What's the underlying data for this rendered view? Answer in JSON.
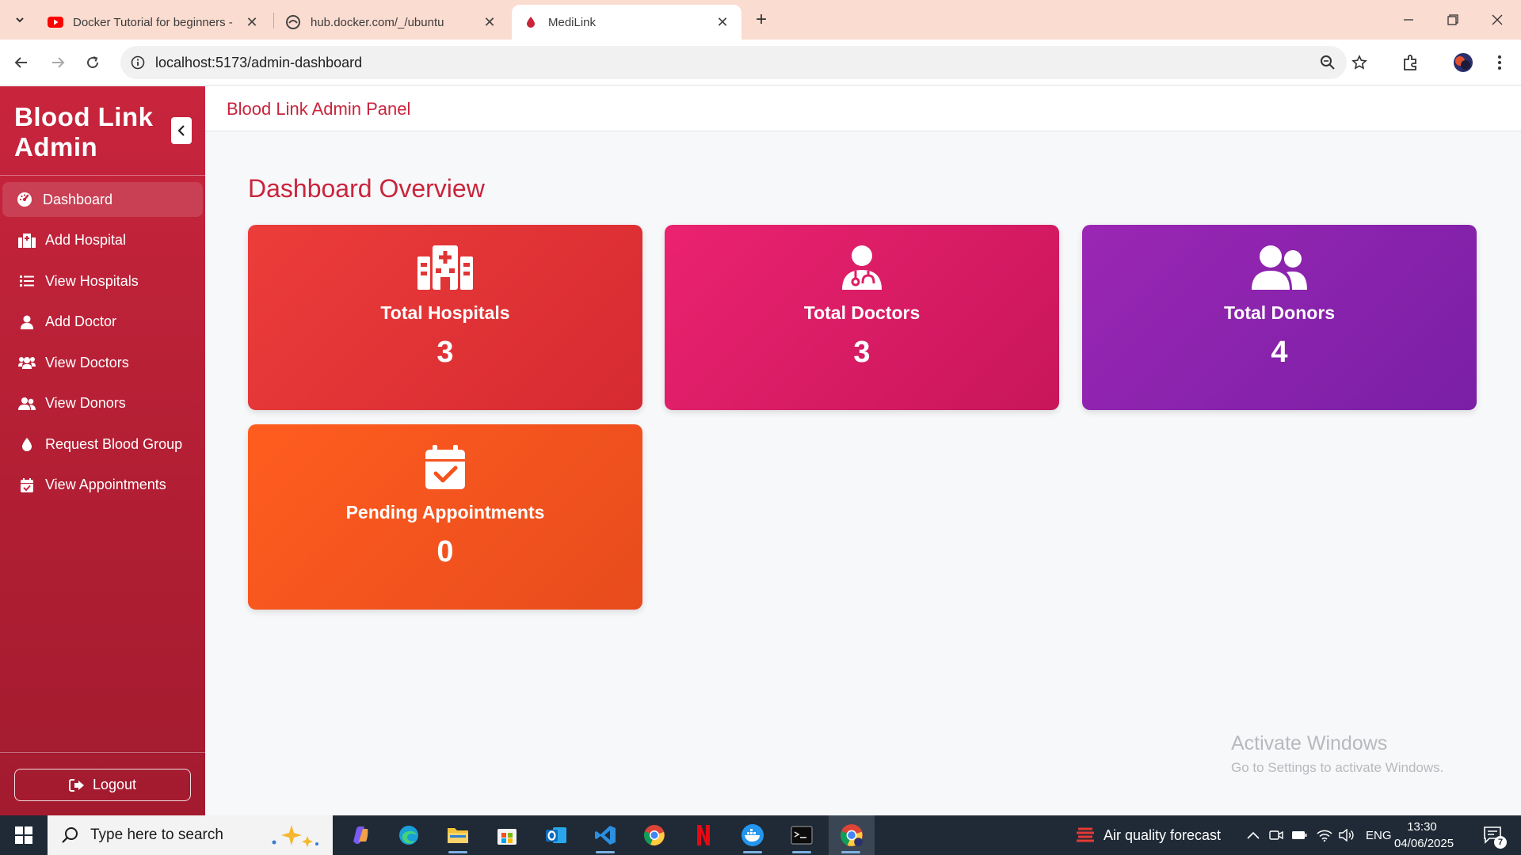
{
  "browser": {
    "tabs": [
      {
        "title": "Docker Tutorial for beginners -",
        "favicon": "youtube-icon"
      },
      {
        "title": "hub.docker.com/_/ubuntu",
        "favicon": "docker-hub-icon"
      },
      {
        "title": "MediLink",
        "favicon": "blood-drop-icon",
        "active": true
      }
    ],
    "url": "localhost:5173/admin-dashboard"
  },
  "sidebar": {
    "brand": "Blood Link Admin",
    "items": [
      {
        "label": "Dashboard",
        "icon": "gauge-icon",
        "active": true
      },
      {
        "label": "Add Hospital",
        "icon": "hospital-icon"
      },
      {
        "label": "View Hospitals",
        "icon": "list-icon"
      },
      {
        "label": "Add Doctor",
        "icon": "user-doctor-icon"
      },
      {
        "label": "View Doctors",
        "icon": "users-icon"
      },
      {
        "label": "View Donors",
        "icon": "user-group-icon"
      },
      {
        "label": "Request Blood Group",
        "icon": "droplet-icon"
      },
      {
        "label": "View Appointments",
        "icon": "calendar-check-icon"
      }
    ],
    "logout_label": "Logout"
  },
  "header": {
    "title": "Blood Link Admin Panel"
  },
  "main": {
    "title": "Dashboard Overview",
    "cards": [
      {
        "label": "Total Hospitals",
        "value": "3",
        "icon": "hospital-icon",
        "color": "#e03535"
      },
      {
        "label": "Total Doctors",
        "value": "3",
        "icon": "user-doctor-icon",
        "color": "#e01e65"
      },
      {
        "label": "Total Donors",
        "value": "4",
        "icon": "user-group-icon",
        "color": "#8a22ad"
      },
      {
        "label": "Pending Appointments",
        "value": "0",
        "icon": "calendar-check-icon",
        "color": "#f5531e"
      }
    ]
  },
  "watermark": {
    "line1": "Activate Windows",
    "line2": "Go to Settings to activate Windows."
  },
  "taskbar": {
    "search_placeholder": "Type here to search",
    "weather": "Air quality forecast",
    "language": "ENG",
    "time": "13:30",
    "date": "04/06/2025",
    "notification_count": "7"
  },
  "colors": {
    "brand_red": "#c8253d",
    "sidebar_dark": "#a31b2f",
    "taskbar": "#1f2a36"
  }
}
